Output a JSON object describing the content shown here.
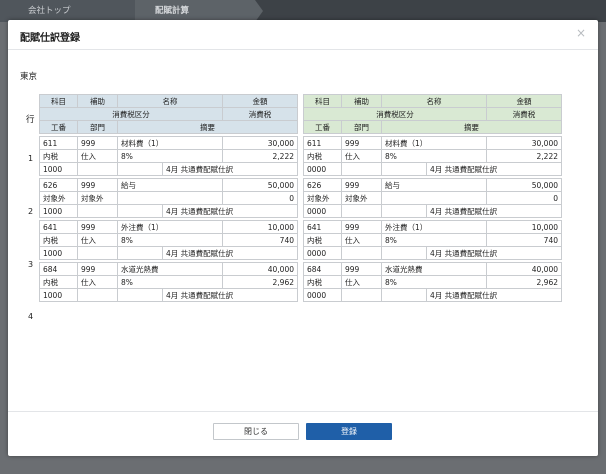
{
  "nav": {
    "items": [
      "会社トップ",
      "配賦計算"
    ]
  },
  "dialog": {
    "title": "配賦仕訳登録",
    "close_icon": "×",
    "office": "東京",
    "row_header": "行",
    "headers": {
      "kamoku": "科目",
      "hojo": "補助",
      "meisho": "名称",
      "kingaku": "金額",
      "zeikubun": "消費税区分",
      "shohizei": "消費税",
      "koban": "工番",
      "bumon": "部門",
      "tekiyo": "摘要"
    },
    "rows": [
      {
        "num": "1",
        "debit": {
          "code": "611",
          "sub": "999",
          "name": "材料費（1）",
          "amount": "30,000",
          "tax_type": "内税",
          "tax_cat": "仕入",
          "rate": "8%",
          "tax": "2,222",
          "koban": "1000",
          "memo": "4月 共通費配賦仕訳"
        },
        "credit": {
          "code": "611",
          "sub": "999",
          "name": "材料費（1）",
          "amount": "30,000",
          "tax_type": "内税",
          "tax_cat": "仕入",
          "rate": "8%",
          "tax": "2,222",
          "koban": "0000",
          "memo": "4月 共通費配賦仕訳"
        }
      },
      {
        "num": "2",
        "debit": {
          "code": "626",
          "sub": "999",
          "name": "給与",
          "amount": "50,000",
          "tax_type": "対象外",
          "tax_cat": "対象外",
          "rate": "",
          "tax": "0",
          "koban": "1000",
          "memo": "4月 共通費配賦仕訳"
        },
        "credit": {
          "code": "626",
          "sub": "999",
          "name": "給与",
          "amount": "50,000",
          "tax_type": "対象外",
          "tax_cat": "対象外",
          "rate": "",
          "tax": "0",
          "koban": "0000",
          "memo": "4月 共通費配賦仕訳"
        }
      },
      {
        "num": "3",
        "debit": {
          "code": "641",
          "sub": "999",
          "name": "外注費（1）",
          "amount": "10,000",
          "tax_type": "内税",
          "tax_cat": "仕入",
          "rate": "8%",
          "tax": "740",
          "koban": "1000",
          "memo": "4月 共通費配賦仕訳"
        },
        "credit": {
          "code": "641",
          "sub": "999",
          "name": "外注費（1）",
          "amount": "10,000",
          "tax_type": "内税",
          "tax_cat": "仕入",
          "rate": "8%",
          "tax": "740",
          "koban": "0000",
          "memo": "4月 共通費配賦仕訳"
        }
      },
      {
        "num": "4",
        "debit": {
          "code": "684",
          "sub": "999",
          "name": "水道光熱費",
          "amount": "40,000",
          "tax_type": "内税",
          "tax_cat": "仕入",
          "rate": "8%",
          "tax": "2,962",
          "koban": "1000",
          "memo": "4月 共通費配賦仕訳"
        },
        "credit": {
          "code": "684",
          "sub": "999",
          "name": "水道光熱費",
          "amount": "40,000",
          "tax_type": "内税",
          "tax_cat": "仕入",
          "rate": "8%",
          "tax": "2,962",
          "koban": "0000",
          "memo": "4月 共通費配賦仕訳"
        }
      }
    ],
    "buttons": {
      "close": "閉じる",
      "register": "登録"
    }
  },
  "colors": {
    "debit_header": "#d6e2ea",
    "credit_header": "#d9e9d3",
    "primary": "#1f5fa8"
  }
}
